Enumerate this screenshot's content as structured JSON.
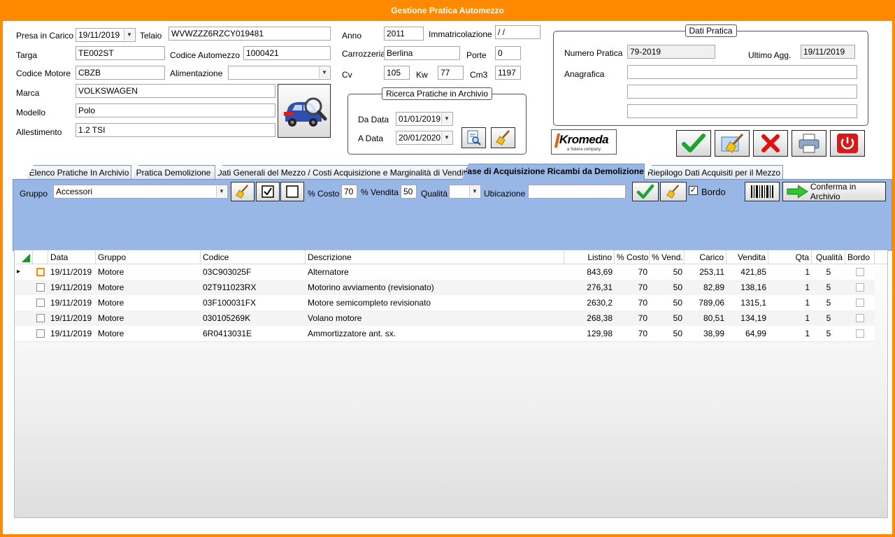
{
  "window": {
    "title": "Gestione Pratica Automezzo"
  },
  "vehicle": {
    "presa_label": "Presa in Carico",
    "presa_value": "19/11/2019",
    "telaio_label": "Telaio",
    "telaio_value": "WVWZZZ6RZCY019481",
    "targa_label": "Targa",
    "targa_value": "TE002ST",
    "codice_auto_label": "Codice Automezzo",
    "codice_auto_value": "1000421",
    "codice_motore_label": "Codice Motore",
    "codice_motore_value": "CBZB",
    "alimentazione_label": "Alimentazione",
    "alimentazione_value": "",
    "marca_label": "Marca",
    "marca_value": "VOLKSWAGEN",
    "modello_label": "Modello",
    "modello_value": "Polo",
    "allestimento_label": "Allestimento",
    "allestimento_value": "1.2 TSI",
    "anno_label": "Anno",
    "anno_value": "2011",
    "immatricolazione_label": "Immatricolazione",
    "immatricolazione_value": " / /",
    "carrozzeria_label": "Carrozzeria",
    "carrozzeria_value": "Berlina",
    "porte_label": "Porte",
    "porte_value": "0",
    "cv_label": "Cv",
    "cv_value": "105",
    "kw_label": "Kw",
    "kw_value": "77",
    "cm3_label": "Cm3",
    "cm3_value": "1197"
  },
  "ricerca": {
    "title": "Ricerca Pratiche in Archivio",
    "da_label": "Da Data",
    "da_value": "01/01/2019",
    "a_label": "A Data",
    "a_value": "20/01/2020"
  },
  "dati_pratica": {
    "title": "Dati Pratica",
    "numero_label": "Numero Pratica",
    "numero_value": "79-2019",
    "ultimo_label": "Ultimo Agg.",
    "ultimo_value": "19/11/2019",
    "anagrafica_label": "Anagrafica",
    "anagrafica_lines": [
      "",
      "",
      ""
    ]
  },
  "logo": {
    "text": "Kromeda",
    "sub": "a Solera company"
  },
  "tabs": [
    {
      "label": "Elenco Pratiche In Archivio"
    },
    {
      "label": "Pratica Demolizione"
    },
    {
      "label": "Dati Generali del Mezzo / Costi Acquisizione e  Marginalità di Vendita"
    },
    {
      "label": "Fase di Acquisizione Ricambi da Demolizione"
    },
    {
      "label": "Riepilogo Dati Acquisiti per il Mezzo"
    }
  ],
  "filter": {
    "gruppo_label": "Gruppo",
    "gruppo_value": "Accessori",
    "costo_label": "% Costo",
    "costo_value": "70",
    "vendita_label": "% Vendita",
    "vendita_value": "50",
    "qualita_label": "Qualità",
    "qualita_value": "",
    "ubicazione_label": "Ubicazione",
    "ubicazione_value": "",
    "bordo_label": "Bordo",
    "conferma_label": "Conferma in Archivio"
  },
  "grid": {
    "headers": [
      "Data",
      "Gruppo",
      "Codice",
      "Descrizione",
      "Listino",
      "% Costo",
      "% Vend.",
      "Carico",
      "Vendita",
      "Qta",
      "Qualità",
      "Bordo"
    ],
    "rows": [
      {
        "data": "19/11/2019",
        "gruppo": "Motore",
        "codice": "03C903025F",
        "descrizione": "Alternatore",
        "listino": "843,69",
        "costo": "70",
        "vend": "50",
        "carico": "253,11",
        "vendita": "421,85",
        "qta": "1",
        "qualita": "5"
      },
      {
        "data": "19/11/2019",
        "gruppo": "Motore",
        "codice": "02T911023RX",
        "descrizione": "Motorino avviamento (revisionato)",
        "listino": "276,31",
        "costo": "70",
        "vend": "50",
        "carico": "82,89",
        "vendita": "138,16",
        "qta": "1",
        "qualita": "5"
      },
      {
        "data": "19/11/2019",
        "gruppo": "Motore",
        "codice": "03F100031FX",
        "descrizione": "Motore semicompleto revisionato",
        "listino": "2630,2",
        "costo": "70",
        "vend": "50",
        "carico": "789,06",
        "vendita": "1315,1",
        "qta": "1",
        "qualita": "5"
      },
      {
        "data": "19/11/2019",
        "gruppo": "Motore",
        "codice": "030105269K",
        "descrizione": "Volano motore",
        "listino": "268,38",
        "costo": "70",
        "vend": "50",
        "carico": "80,51",
        "vendita": "134,19",
        "qta": "1",
        "qualita": "5"
      },
      {
        "data": "19/11/2019",
        "gruppo": "Motore",
        "codice": "6R0413031E",
        "descrizione": "Ammortizzatore  ant. sx.",
        "listino": "129,98",
        "costo": "70",
        "vend": "50",
        "carico": "38,99",
        "vendita": "64,99",
        "qta": "1",
        "qualita": "5"
      }
    ]
  },
  "colors": {
    "accent": "#ff8a00",
    "panel": "#98b7e6"
  }
}
